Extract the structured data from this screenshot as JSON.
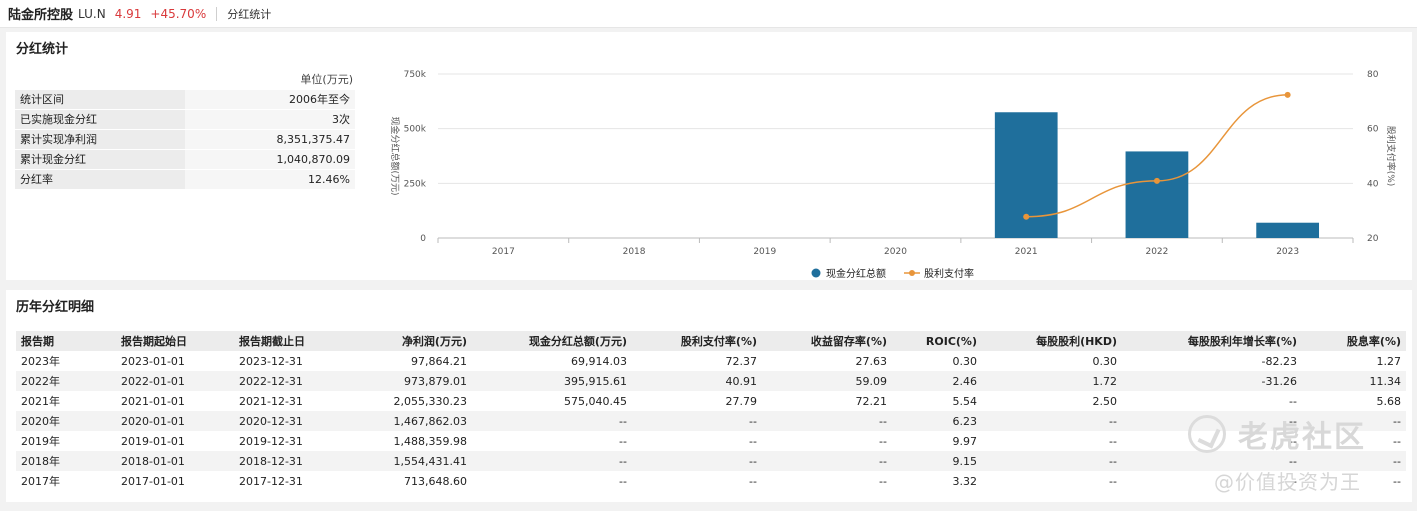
{
  "header": {
    "stock_name": "陆金所控股",
    "ticker": "LU.N",
    "price": "4.91",
    "change_pct": "+45.70%",
    "breadcrumb": "分红统计"
  },
  "summary": {
    "title": "分红统计",
    "unit": "单位(万元)",
    "rows": [
      {
        "label": "统计区间",
        "value": "2006年至今"
      },
      {
        "label": "已实施现金分红",
        "value": "3次"
      },
      {
        "label": "累计实现净利润",
        "value": "8,351,375.47"
      },
      {
        "label": "累计现金分红",
        "value": "1,040,870.09"
      },
      {
        "label": "分红率",
        "value": "12.46%"
      }
    ]
  },
  "chart_data": {
    "type": "bar",
    "categories": [
      "2017",
      "2018",
      "2019",
      "2020",
      "2021",
      "2022",
      "2023"
    ],
    "series": [
      {
        "name": "现金分红总额",
        "type": "bar",
        "axis": "left",
        "color": "#1f6f9c",
        "values": [
          null,
          null,
          null,
          null,
          575040.45,
          395915.61,
          69914.03
        ]
      },
      {
        "name": "股利支付率",
        "type": "line",
        "axis": "right",
        "color": "#e8953a",
        "values": [
          null,
          null,
          null,
          null,
          27.79,
          40.91,
          72.37
        ]
      }
    ],
    "y_left": {
      "label": "现金分红总额(万元)",
      "ticks": [
        "0",
        "250k",
        "500k",
        "750k"
      ],
      "range": [
        0,
        750000
      ]
    },
    "y_right": {
      "label": "股利支付率(%)",
      "ticks": [
        "20",
        "40",
        "60",
        "80"
      ],
      "range": [
        20,
        80
      ]
    },
    "legend_position": "bottom-center",
    "grid": true
  },
  "history": {
    "title": "历年分红明细",
    "columns": [
      "报告期",
      "报告期起始日",
      "报告期截止日",
      "净利润(万元)",
      "现金分红总额(万元)",
      "股利支付率(%)",
      "收益留存率(%)",
      "ROIC(%)",
      "每股股利(HKD)",
      "每股股利年增长率(%)",
      "股息率(%)"
    ],
    "rows": [
      [
        "2023年",
        "2023-01-01",
        "2023-12-31",
        "97,864.21",
        "69,914.03",
        "72.37",
        "27.63",
        "0.30",
        "0.30",
        "-82.23",
        "1.27"
      ],
      [
        "2022年",
        "2022-01-01",
        "2022-12-31",
        "973,879.01",
        "395,915.61",
        "40.91",
        "59.09",
        "2.46",
        "1.72",
        "-31.26",
        "11.34"
      ],
      [
        "2021年",
        "2021-01-01",
        "2021-12-31",
        "2,055,330.23",
        "575,040.45",
        "27.79",
        "72.21",
        "5.54",
        "2.50",
        "--",
        "5.68"
      ],
      [
        "2020年",
        "2020-01-01",
        "2020-12-31",
        "1,467,862.03",
        "--",
        "--",
        "--",
        "6.23",
        "--",
        "--",
        "--"
      ],
      [
        "2019年",
        "2019-01-01",
        "2019-12-31",
        "1,488,359.98",
        "--",
        "--",
        "--",
        "9.97",
        "--",
        "--",
        "--"
      ],
      [
        "2018年",
        "2018-01-01",
        "2018-12-31",
        "1,554,431.41",
        "--",
        "--",
        "--",
        "9.15",
        "--",
        "--",
        "--"
      ],
      [
        "2017年",
        "2017-01-01",
        "2017-12-31",
        "713,648.60",
        "--",
        "--",
        "--",
        "3.32",
        "--",
        "--",
        "--"
      ]
    ]
  },
  "watermark": {
    "brand": "老虎社区",
    "author": "@价值投资为王"
  }
}
